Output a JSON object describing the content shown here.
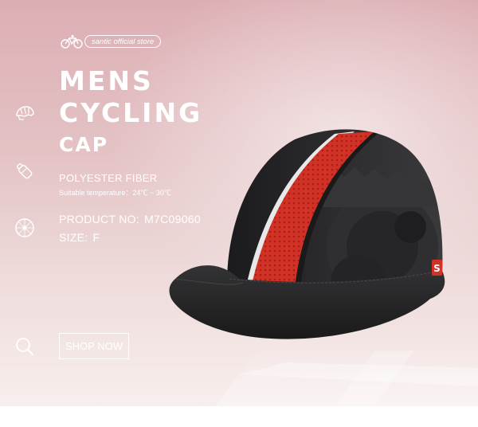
{
  "brand": {
    "store_label": "santic official store",
    "icon": "bicycle-icon"
  },
  "title": {
    "line1": "MENS",
    "line2": "CYCLING",
    "line3": "CAP"
  },
  "side_icons": [
    "helmet-icon",
    "bottle-icon",
    "wheel-icon",
    "search-icon"
  ],
  "material": {
    "name": "POLYESTER FIBER",
    "temperature": "Suitable temperature：24℃ ~ 30℃"
  },
  "product": {
    "number_label": "PRODUCT NO:",
    "number_value": "M7C09060",
    "size_label": "SIZE:",
    "size_value": "F"
  },
  "cta": {
    "label": "SHOP NOW"
  },
  "cap_logo": "S",
  "colors": {
    "cap_black": "#2a2a2c",
    "stripe_red": "#d23226",
    "background_pink": "#dcaeb3"
  }
}
